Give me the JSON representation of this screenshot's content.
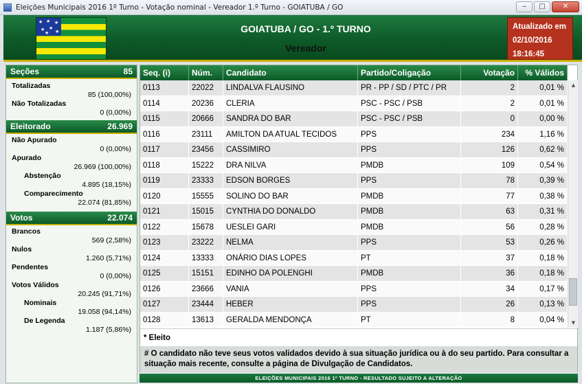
{
  "window": {
    "title": "Eleições Municipais 2016 1º Turno - Votação nominal - Vereador 1.º Turno - GOIATUBA / GO",
    "minimize": "‒",
    "restore": "□",
    "close": "✕"
  },
  "header": {
    "title": "GOIATUBA / GO - 1.º TURNO",
    "subtitle": "Vereador",
    "updated_label": "Atualizado em",
    "updated_date": "02/10/2016",
    "updated_time": "18:16:45",
    "colors": {
      "green": "#0e5a28",
      "accent": "#c9b000",
      "updated_bg": "#b5321e"
    }
  },
  "secoes": {
    "label": "Seções",
    "total": "85",
    "totalizadas_label": "Totalizadas",
    "totalizadas_value": "85 (100,00%)",
    "nao_totalizadas_label": "Não Totalizadas",
    "nao_totalizadas_value": "0 (0,00%)"
  },
  "eleitorado": {
    "label": "Eleitorado",
    "total": "26.969",
    "nao_apurado_label": "Não Apurado",
    "nao_apurado_value": "0 (0,00%)",
    "apurado_label": "Apurado",
    "apurado_value": "26.969 (100,00%)",
    "abstencao_label": "Abstenção",
    "abstencao_value": "4.895 (18,15%)",
    "comparecimento_label": "Comparecimento",
    "comparecimento_value": "22.074 (81,85%)"
  },
  "votos": {
    "label": "Votos",
    "total": "22.074",
    "brancos_label": "Brancos",
    "brancos_value": "569 (2,58%)",
    "nulos_label": "Nulos",
    "nulos_value": "1.260 (5,71%)",
    "pendentes_label": "Pendentes",
    "pendentes_value": "0 (0,00%)",
    "validos_label": "Votos Válidos",
    "validos_value": "20.245 (91,71%)",
    "nominais_label": "Nominais",
    "nominais_value": "19.058 (94,14%)",
    "legenda_label": "De Legenda",
    "legenda_value": "1.187 (5,86%)"
  },
  "table": {
    "headers": [
      "Seq.  (i)",
      "Núm.",
      "Candidato",
      "Partido/Coligação",
      "Votação",
      "% Válidos"
    ],
    "rows": [
      [
        "0113",
        "22022",
        "LINDALVA FLAUSINO",
        "PR - PP / SD / PTC / PR",
        "2",
        "0,01 %"
      ],
      [
        "0114",
        "20236",
        "CLERIA",
        "PSC - PSC / PSB",
        "2",
        "0,01 %"
      ],
      [
        "0115",
        "20666",
        "SANDRA DO BAR",
        "PSC - PSC / PSB",
        "0",
        "0,00 %"
      ],
      [
        "0116",
        "23111",
        "AMILTON DA ATUAL TECIDOS",
        "PPS",
        "234",
        "1,16 %"
      ],
      [
        "0117",
        "23456",
        "CASSIMIRO",
        "PPS",
        "126",
        "0,62 %"
      ],
      [
        "0118",
        "15222",
        "DRA NILVA",
        "PMDB",
        "109",
        "0,54 %"
      ],
      [
        "0119",
        "23333",
        "EDSON BORGES",
        "PPS",
        "78",
        "0,39 %"
      ],
      [
        "0120",
        "15555",
        "SOLINO DO BAR",
        "PMDB",
        "77",
        "0,38 %"
      ],
      [
        "0121",
        "15015",
        "CYNTHIA DO DONALDO",
        "PMDB",
        "63",
        "0,31 %"
      ],
      [
        "0122",
        "15678",
        "UESLEI GARI",
        "PMDB",
        "56",
        "0,28 %"
      ],
      [
        "0123",
        "23222",
        "NELMA",
        "PPS",
        "53",
        "0,26 %"
      ],
      [
        "0124",
        "13333",
        "ONÁRIO DIAS LOPES",
        "PT",
        "37",
        "0,18 %"
      ],
      [
        "0125",
        "15151",
        "EDINHO DA POLENGHI",
        "PMDB",
        "36",
        "0,18 %"
      ],
      [
        "0126",
        "23666",
        "VANIA",
        "PPS",
        "34",
        "0,17 %"
      ],
      [
        "0127",
        "23444",
        "HEBER",
        "PPS",
        "26",
        "0,13 %"
      ],
      [
        "0128",
        "13613",
        "GERALDA MENDONÇA",
        "PT",
        "8",
        "0,04 %"
      ]
    ],
    "eleito_legend": "* Eleito",
    "note": "# O candidato não teve seus votos validados devido à sua situação jurídica ou à do seu partido. Para consultar a situação mais recente, consulte a página de Divulgação de Candidatos."
  },
  "footer": "ELEIÇÕES MUNICIPAIS 2016 1º TURNO - RESULTADO SUJEITO A ALTERAÇÃO"
}
